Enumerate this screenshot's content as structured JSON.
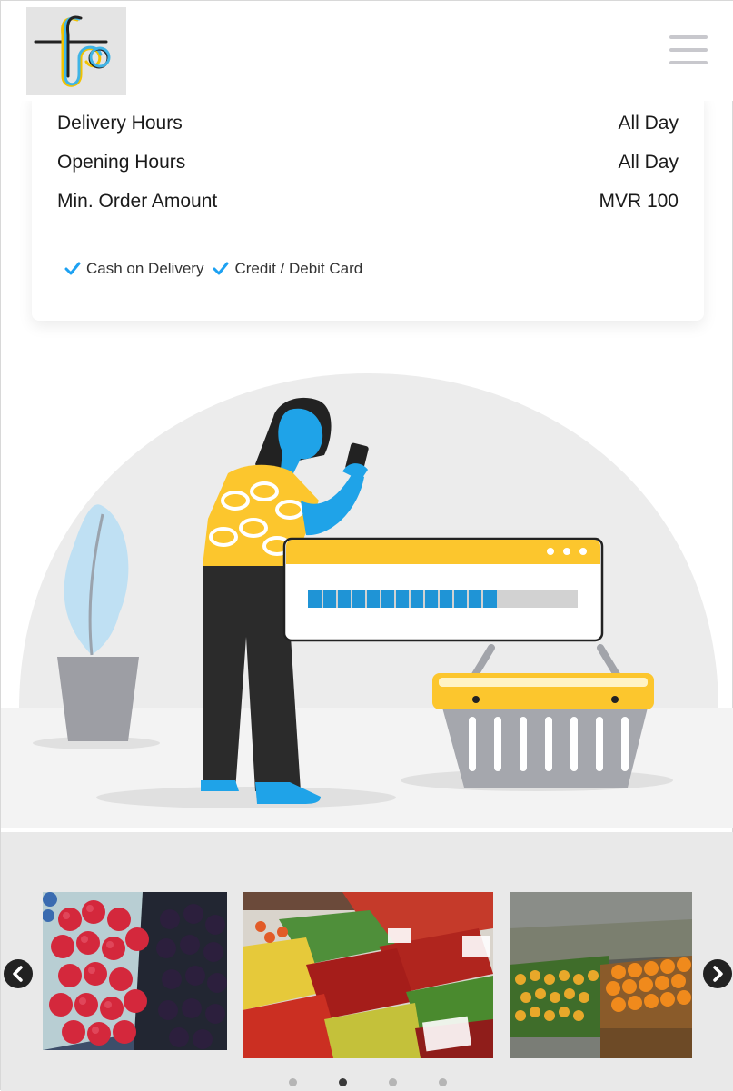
{
  "info": {
    "rows": [
      {
        "label": "Delivery Hours",
        "value": "All Day"
      },
      {
        "label": "Opening Hours",
        "value": "All Day"
      },
      {
        "label": "Min. Order Amount",
        "value": "MVR 100"
      }
    ],
    "payments": [
      "Cash on Delivery",
      "Credit / Debit Card"
    ]
  },
  "colors": {
    "check": "#1da1f2",
    "illustration_yellow": "#fcc62d",
    "illustration_blue": "#1fa3e8",
    "progress": "#1f94d6"
  },
  "illustration": {
    "progress_fraction": 0.7
  },
  "gallery": {
    "slides": [
      "raspberries-blackberries-photo",
      "peppers-market-photo",
      "fruit-stall-photo"
    ],
    "dot_count": 4,
    "active_dot": 1
  }
}
